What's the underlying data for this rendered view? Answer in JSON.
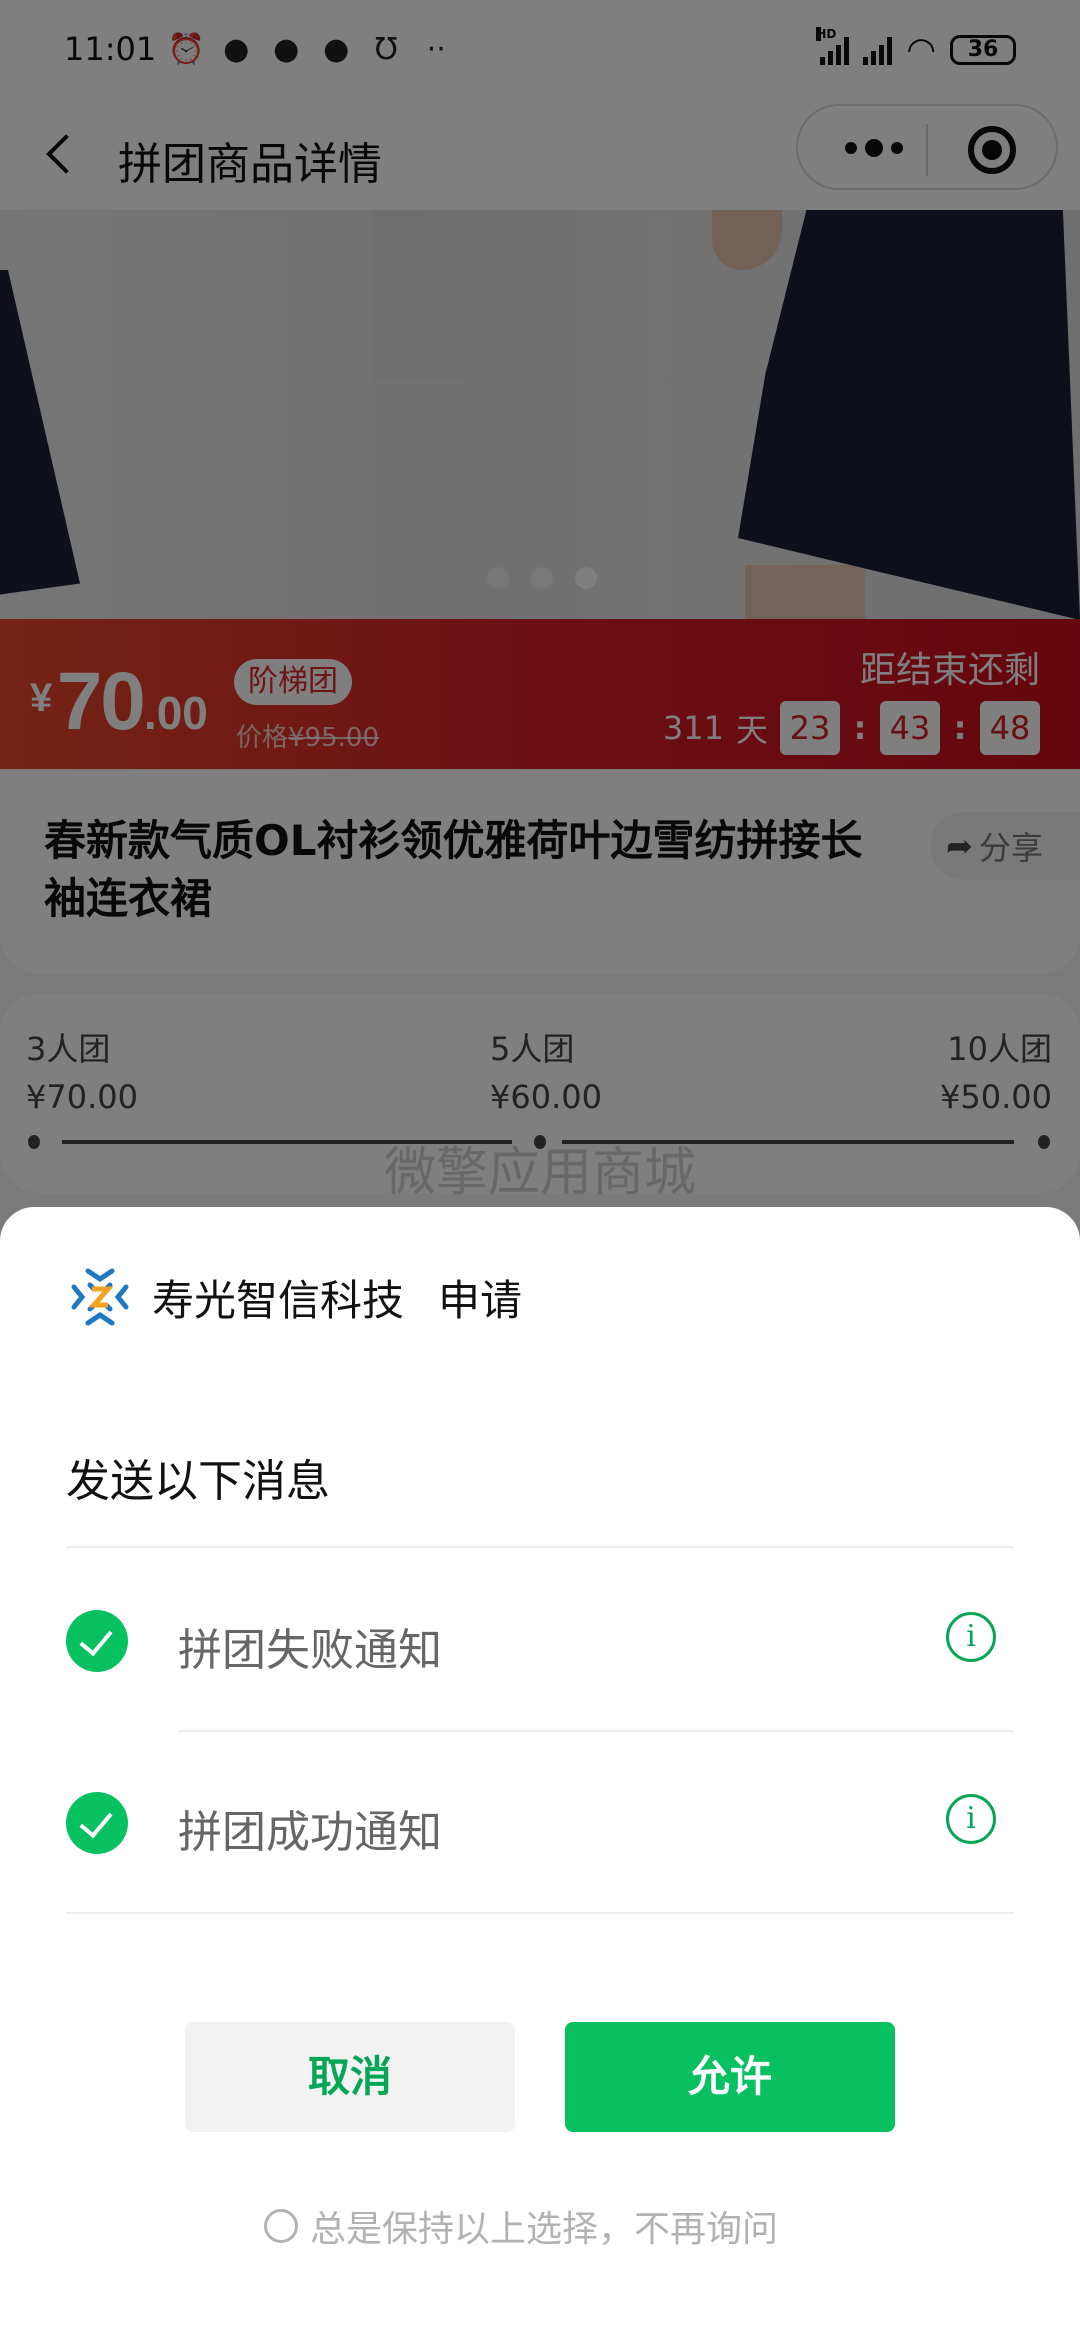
{
  "status_bar": {
    "time": "11:01",
    "left_icons": [
      "alarm-icon",
      "wechat-icon",
      "wechat-icon",
      "wechat-icon",
      "bull-icon",
      "more-notifications-icon"
    ],
    "hd_label": "HD",
    "battery": "36"
  },
  "nav": {
    "title": "拼团商品详情",
    "back_icon": "chevron-left-icon",
    "more_icon": "more-dots-icon",
    "close_icon": "target-circle-icon"
  },
  "carousel": {
    "slide_count": 3,
    "active_index": 2
  },
  "price_bar": {
    "currency": "¥",
    "price_int": "70",
    "price_dec": ".00",
    "badge": "阶梯团",
    "orig_label": "价格",
    "orig_price": "¥95.00",
    "countdown_label": "距结束还剩",
    "days": "311",
    "days_unit": "天",
    "hours": "23",
    "minutes": "43",
    "seconds": "48",
    "separator": ":"
  },
  "product": {
    "title": "春新款气质OL衬衫领优雅荷叶边雪纺拼接长袖连衣裙",
    "share_label": "分享",
    "share_icon": "share-arrow-icon"
  },
  "tiers": [
    {
      "label": "3人团",
      "price": "¥70.00"
    },
    {
      "label": "5人团",
      "price": "¥60.00"
    },
    {
      "label": "10人团",
      "price": "¥50.00"
    }
  ],
  "watermark": "微擎应用商城",
  "sheet": {
    "app_name": "寿光智信科技",
    "request_label": "申请",
    "subtitle": "发送以下消息",
    "permissions": [
      {
        "label": "拼团失败通知",
        "checked": true
      },
      {
        "label": "拼团成功通知",
        "checked": true
      }
    ],
    "cancel_label": "取消",
    "allow_label": "允许",
    "always_label": "总是保持以上选择，不再询问",
    "always_checked": false
  },
  "colors": {
    "wechat_green": "#07c160",
    "price_red": "#d8202a"
  }
}
